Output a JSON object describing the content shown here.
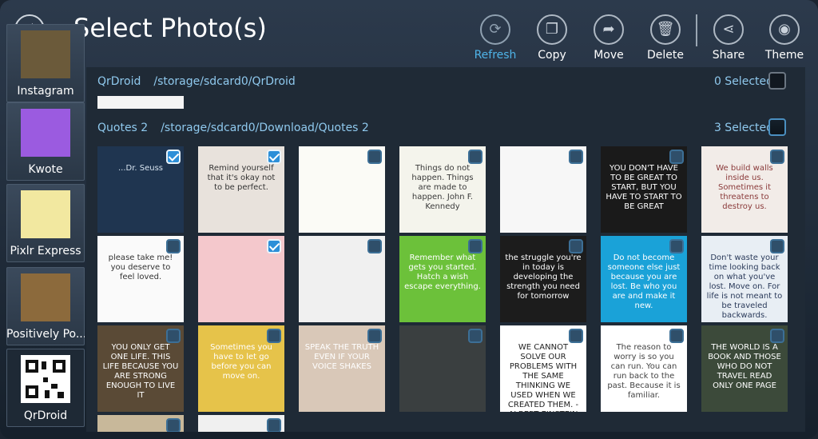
{
  "header": {
    "title": "Select Photo(s)",
    "tools": [
      {
        "name": "refresh-button",
        "icon": "refresh-icon",
        "glyph": "⟳",
        "label": "Refresh",
        "active": true
      },
      {
        "name": "copy-button",
        "icon": "copy-icon",
        "glyph": "❐",
        "label": "Copy",
        "active": false
      },
      {
        "name": "move-button",
        "icon": "move-icon",
        "glyph": "➦",
        "label": "Move",
        "active": false
      },
      {
        "name": "delete-button",
        "icon": "trash-icon",
        "glyph": "🗑",
        "label": "Delete",
        "active": false
      },
      {
        "name": "share-button",
        "icon": "share-icon",
        "glyph": "⋖",
        "label": "Share",
        "active": false
      },
      {
        "name": "theme-button",
        "icon": "camera-icon",
        "glyph": "◉",
        "label": "Theme",
        "active": false
      }
    ]
  },
  "sidebar": {
    "albums": [
      {
        "name": "album-instagram",
        "label": "Instagram",
        "color": "#6b5a3a"
      },
      {
        "name": "album-kwote",
        "label": "Kwote",
        "color": "#9b5be0"
      },
      {
        "name": "album-pixlr-express",
        "label": "Pixlr Express",
        "color": "#f2e8a0"
      },
      {
        "name": "album-positively-po",
        "label": "Positively Po...",
        "color": "#8c6a3c"
      },
      {
        "name": "album-qrdroid",
        "label": "QrDroid",
        "color": "#ffffff"
      }
    ]
  },
  "groups": [
    {
      "name": "QrDroid",
      "path": "/storage/sdcard0/QrDroid",
      "selected": "0 Selected"
    },
    {
      "name": "Quotes 2",
      "path": "/storage/sdcard0/Download/Quotes 2",
      "selected": "3 Selected"
    }
  ],
  "photos": [
    {
      "bg": "#1f3550",
      "fg": "#d8e4f0",
      "text": "...Dr. Seuss",
      "checked": true
    },
    {
      "bg": "#e8e2dc",
      "fg": "#333333",
      "text": "Remind yourself that it's okay not to be perfect.",
      "checked": true
    },
    {
      "bg": "#fbfbf6",
      "fg": "#c9a12a",
      "text": "",
      "checked": false
    },
    {
      "bg": "#f4f4ec",
      "fg": "#3a3a3a",
      "text": "Things do not happen. Things are made to happen. John F. Kennedy",
      "checked": false
    },
    {
      "bg": "#f7f7f7",
      "fg": "#777777",
      "text": "",
      "checked": false
    },
    {
      "bg": "#1a1a1a",
      "fg": "#ffffff",
      "text": "YOU DON'T HAVE TO BE GREAT TO START, BUT YOU HAVE TO START TO BE GREAT",
      "checked": false
    },
    {
      "bg": "#f2ece8",
      "fg": "#8a3a3a",
      "text": "We build walls inside us. Sometimes it threatens to destroy us.",
      "checked": false
    },
    {
      "bg": "#fafafa",
      "fg": "#333333",
      "text": "please take me! you deserve to feel loved.",
      "checked": false
    },
    {
      "bg": "#f4c8cc",
      "fg": "#555555",
      "text": "",
      "checked": true
    },
    {
      "bg": "#f0f0f0",
      "fg": "#666666",
      "text": "",
      "checked": false
    },
    {
      "bg": "#6cc13a",
      "fg": "#ffffff",
      "text": "Remember what gets you started. Hatch a wish escape everything.",
      "checked": false
    },
    {
      "bg": "#1c1c1c",
      "fg": "#ffffff",
      "text": "the struggle you're in today is developing the strength you need for tomorrow",
      "checked": false
    },
    {
      "bg": "#1aa2d8",
      "fg": "#ffffff",
      "text": "Do not become someone else just because you are lost. Be who you are and make it new.",
      "checked": false
    },
    {
      "bg": "#e8eef4",
      "fg": "#2a3a5a",
      "text": "Don't waste your time looking back on what you've lost. Move on. For life is not meant to be traveled backwards.",
      "checked": false
    },
    {
      "bg": "#5a4a36",
      "fg": "#ffffff",
      "text": "YOU ONLY GET ONE LIFE. THIS LIFE BECAUSE YOU ARE STRONG ENOUGH TO LIVE IT",
      "checked": false
    },
    {
      "bg": "#e6c34a",
      "fg": "#ffffff",
      "text": "Sometimes you have to let go before you can move on.",
      "checked": false
    },
    {
      "bg": "#d9c8b8",
      "fg": "#ffffff",
      "text": "SPEAK THE TRUTH EVEN IF YOUR VOICE SHAKES",
      "checked": false
    },
    {
      "bg": "#3a3f40",
      "fg": "#ffffff",
      "text": "",
      "checked": false
    },
    {
      "bg": "#ffffff",
      "fg": "#222222",
      "text": "WE CANNOT SOLVE OUR PROBLEMS WITH THE SAME THINKING WE USED WHEN WE CREATED THEM. - ALBERT EINSTEIN",
      "checked": false
    },
    {
      "bg": "#ffffff",
      "fg": "#444444",
      "text": "The reason to worry is so you can run. You can run back to the past. Because it is familiar.",
      "checked": false
    },
    {
      "bg": "#3c4a3a",
      "fg": "#ffffff",
      "text": "THE WORLD IS A BOOK AND THOSE WHO DO NOT TRAVEL READ ONLY ONE PAGE",
      "checked": false
    }
  ]
}
